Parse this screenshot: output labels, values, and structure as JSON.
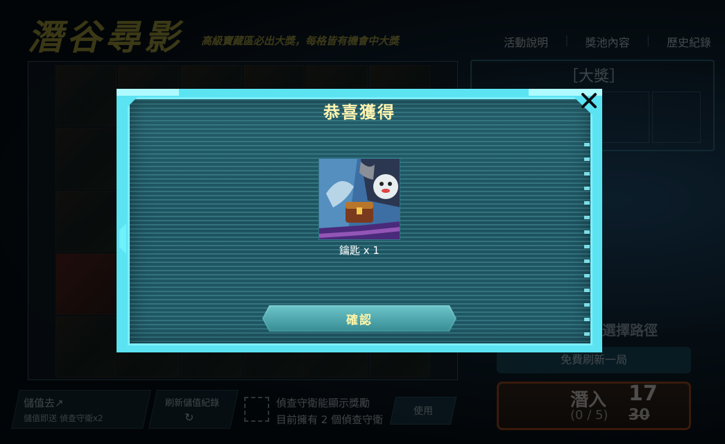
{
  "background": {
    "logo": "潛谷尋影",
    "tagline": "高級寶藏區必出大獎，每格皆有機會中大獎",
    "nav": [
      "活動說明",
      "獎池內容",
      "歷史紀錄"
    ],
    "big_prize_label": "［大獎］",
    "hint": "請先點擊地圖，選擇路徑",
    "free_refresh": "免費刷新一局",
    "dive": {
      "label": "潛入",
      "count": "(0 / 5)",
      "price": "17",
      "old_price": "30"
    },
    "bottom": {
      "recharge_title": "儲值去↗",
      "recharge_sub": "儲值即送 偵查守衛x2",
      "record_title": "刷新儲值紀錄",
      "record_icon": "↻",
      "guard_line1": "偵查守衛能顯示獎勵",
      "guard_line2": "目前擁有 2 個偵查守衛",
      "use": "使用"
    }
  },
  "modal": {
    "title": "恭喜獲得",
    "reward_caption": "鑰匙 x 1",
    "confirm_label": "確認",
    "close_icon": "close-icon",
    "accent": "#5be3f2",
    "title_color": "#fff4b0"
  }
}
